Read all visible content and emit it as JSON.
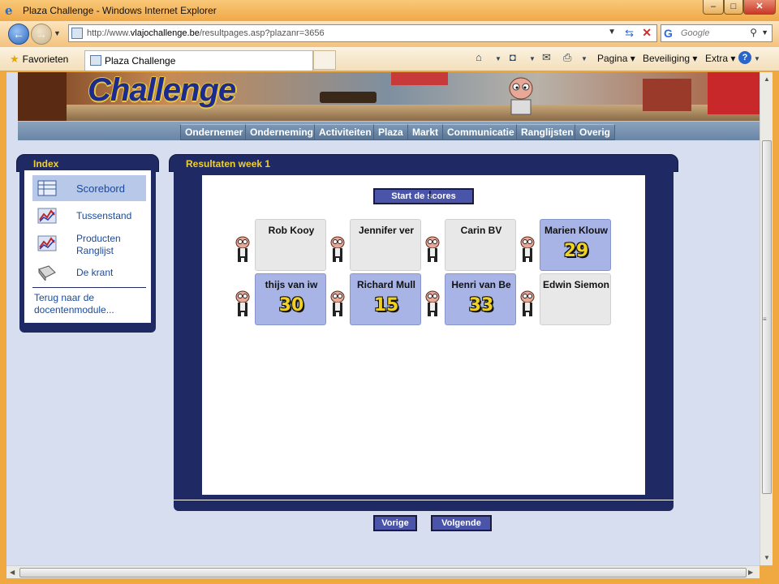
{
  "window": {
    "title": "Plaza Challenge - Windows Internet Explorer"
  },
  "address": {
    "prefix": "http://www.",
    "domain": "vlajochallenge.be",
    "path": "/resultpages.asp?plazanr=3656"
  },
  "search": {
    "placeholder": "Google"
  },
  "favorites": {
    "label": "Favorieten"
  },
  "tab": {
    "title": "Plaza Challenge"
  },
  "commandbar": {
    "page": "Pagina",
    "security": "Beveiliging",
    "extra": "Extra"
  },
  "site": {
    "logo": "Challenge",
    "menu": [
      "Ondernemer",
      "Onderneming",
      "Activiteiten",
      "Plaza",
      "Markt",
      "Communicatie",
      "Ranglijsten",
      "Overig"
    ]
  },
  "index": {
    "title": "Index",
    "items": [
      {
        "label": "Scorebord",
        "icon": "scoreboard-icon",
        "active": true
      },
      {
        "label": "Tussenstand",
        "icon": "chart-icon"
      },
      {
        "label": "Producten Ranglijst",
        "icon": "chart-icon"
      },
      {
        "label": "De krant",
        "icon": "newspaper-icon"
      }
    ],
    "back": "Terug naar de docentenmodule..."
  },
  "results": {
    "title": "Resultaten week 1",
    "start_button": "Start de scores",
    "cards": [
      {
        "name": "Rob Kooy",
        "score": ""
      },
      {
        "name": "Jennifer ver",
        "score": ""
      },
      {
        "name": "Carin BV",
        "score": ""
      },
      {
        "name": "Marien Klouw",
        "score": "29"
      },
      {
        "name": "thijs van iw",
        "score": "30"
      },
      {
        "name": "Richard Mull",
        "score": "15"
      },
      {
        "name": "Henri van Be",
        "score": "33"
      },
      {
        "name": "Edwin Siemon",
        "score": ""
      }
    ],
    "prev_button": "Vorige",
    "next_button": "Volgende"
  },
  "colors": {
    "panel": "#1f2a64",
    "accent_yellow": "#f0d030",
    "score_card": "#a8b4e6"
  }
}
